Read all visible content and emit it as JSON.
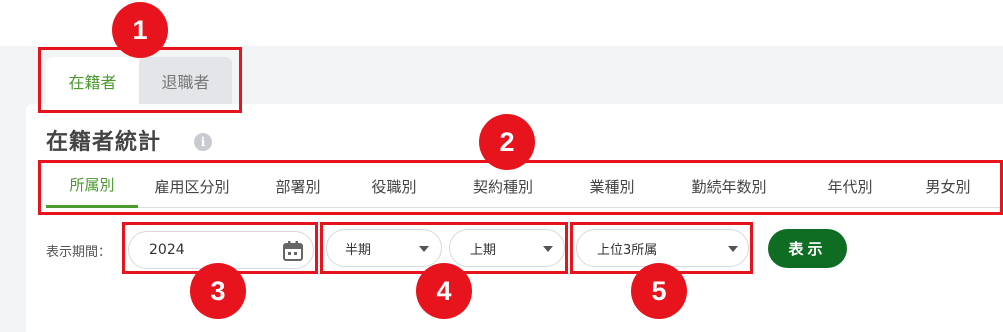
{
  "status_tabs": [
    {
      "label": "在籍者",
      "active": true
    },
    {
      "label": "退職者",
      "active": false
    }
  ],
  "page_title": "在籍者統計",
  "info_icon": "i",
  "category_tabs": [
    {
      "label": "所属別",
      "active": true
    },
    {
      "label": "雇用区分別"
    },
    {
      "label": "部署別"
    },
    {
      "label": "役職別"
    },
    {
      "label": "契約種別"
    },
    {
      "label": "業種別"
    },
    {
      "label": "勤続年数別"
    },
    {
      "label": "年代別"
    },
    {
      "label": "男女別"
    }
  ],
  "filters": {
    "period_label": "表示期間：",
    "year_value": "2024",
    "period_type": "半期",
    "half": "上期",
    "rank": "上位3所属",
    "show_button": "表示"
  },
  "annotations": [
    "1",
    "2",
    "3",
    "4",
    "5"
  ],
  "colors": {
    "accent_green": "#4a9a2e",
    "button_green": "#0f6d23",
    "highlight_red": "#e8141d"
  }
}
